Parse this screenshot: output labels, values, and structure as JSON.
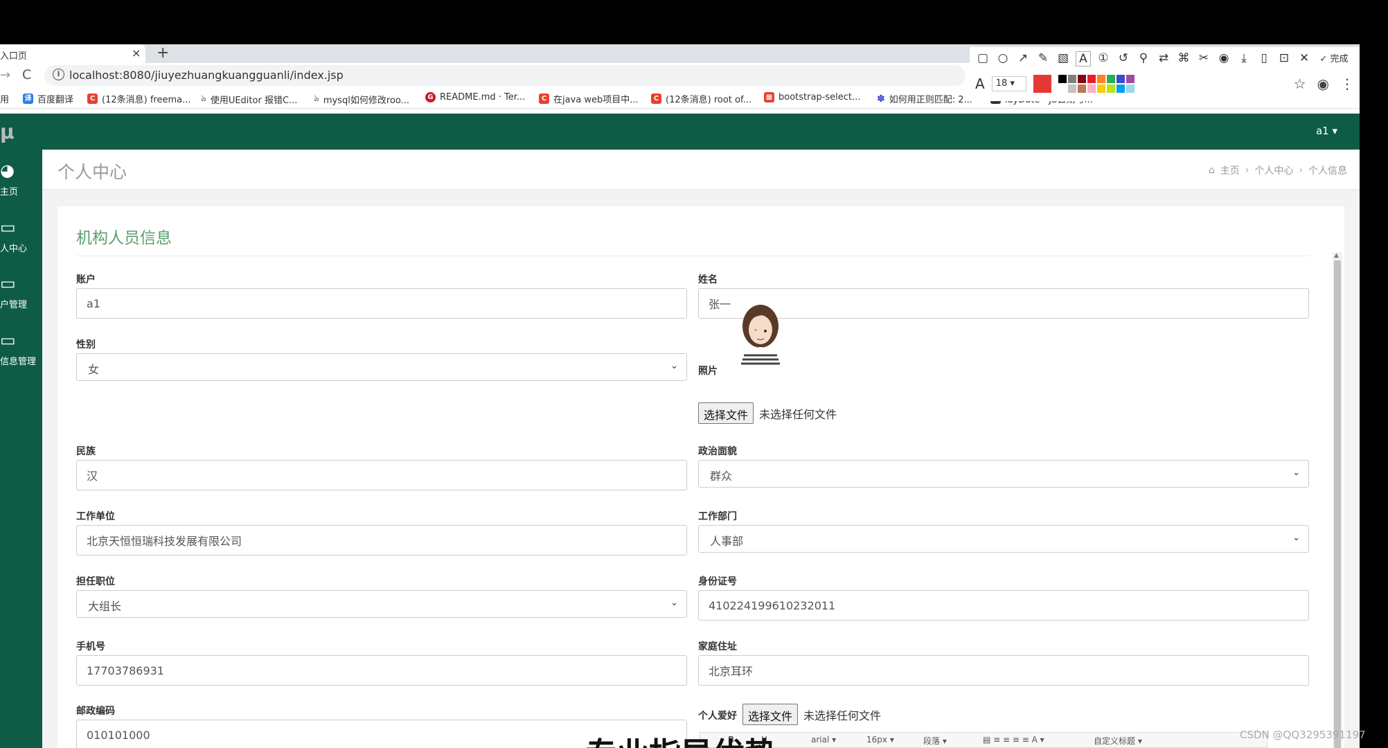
{
  "browser": {
    "tab_title": "入口页",
    "tab_close": "×",
    "new_tab": "+",
    "back": "→",
    "reload": "C",
    "info": "i",
    "url": "localhost:8080/jiuyezhuangkuangguanli/index.jsp",
    "bookmarks": [
      {
        "label": "用",
        "icon": "apps-icon",
        "color": ""
      },
      {
        "label": "百度翻译",
        "icon": "translate-icon",
        "color": "#2b7de9"
      },
      {
        "label": "(12条消息) freema...",
        "icon": "csdn-icon",
        "color": "#e8412c"
      },
      {
        "label": "使用UEditor 报错C...",
        "icon": "link-icon",
        "color": ""
      },
      {
        "label": "mysql如何修改roo...",
        "icon": "link-icon",
        "color": ""
      },
      {
        "label": "README.md · Ter...",
        "icon": "gitee-icon",
        "color": "#c71d23"
      },
      {
        "label": "在java web项目中...",
        "icon": "csdn-icon",
        "color": "#e8412c"
      },
      {
        "label": "(12条消息) root of...",
        "icon": "csdn-icon",
        "color": "#e8412c"
      },
      {
        "label": "bootstrap-select...",
        "icon": "bookmark-icon",
        "color": "#e8412c"
      },
      {
        "label": "如何用正则匹配: 2...",
        "icon": "baidu-icon",
        "color": "#2b3bd6"
      },
      {
        "label": "layDate - JS日期与...",
        "icon": "laydate-icon",
        "color": "#333"
      }
    ]
  },
  "snaptool": {
    "icons": [
      "rect-icon",
      "circle-icon",
      "arrow-icon",
      "pen-icon",
      "mosaic-icon",
      "text-icon",
      "number-icon",
      "undo-icon",
      "pin-icon",
      "translate-icon",
      "ocr-icon",
      "scissors-icon",
      "record-icon",
      "download-icon",
      "phone-icon",
      "save-icon",
      "close-icon"
    ],
    "done_label": "✓ 完成",
    "font_label": "A",
    "font_size": "18",
    "current_color": "#e53935",
    "palette": [
      "#000000",
      "#7f7f7f",
      "#880015",
      "#ed1c24",
      "#ff7f27",
      "#22b14c",
      "#3f48cc",
      "#a349a4",
      "#ffffff",
      "#c3c3c3",
      "#b97a57",
      "#ffaec9",
      "#ffc90e",
      "#b5e61d",
      "#00a2e8",
      "#99d9ea"
    ]
  },
  "app": {
    "logo": "μ",
    "user": "a1 ▾"
  },
  "sidebar": {
    "items": [
      {
        "label": "主页",
        "icon": "dashboard-icon"
      },
      {
        "label": "人中心",
        "icon": "monitor-icon"
      },
      {
        "label": "户管理",
        "icon": "monitor-icon"
      },
      {
        "label": "信息管理",
        "icon": "monitor-icon"
      }
    ]
  },
  "header": {
    "title": "个人中心",
    "breadcrumb": [
      "主页",
      "个人中心",
      "个人信息"
    ],
    "sep": "›"
  },
  "form": {
    "title": "机构人员信息",
    "account_label": "账户",
    "account": "a1",
    "name_label": "姓名",
    "name": "张一",
    "gender_label": "性别",
    "gender": "女",
    "photo_label": "照片",
    "choose_file": "选择文件",
    "no_file": "未选择任何文件",
    "ethnicity_label": "民族",
    "ethnicity": "汉",
    "politics_label": "政治面貌",
    "politics": "群众",
    "workplace_label": "工作单位",
    "workplace": "北京天恒恒瑞科技发展有限公司",
    "department_label": "工作部门",
    "department": "人事部",
    "position_label": "担任职位",
    "position": "大组长",
    "idcard_label": "身份证号",
    "idcard": "410224199610232011",
    "phone_label": "手机号",
    "phone": "17703786931",
    "address_label": "家庭住址",
    "address": "北京耳环",
    "zip_label": "邮政编码",
    "zip": "010101000",
    "hobby_label": "个人爱好"
  },
  "editor": {
    "font": "arial",
    "size": "16px",
    "para": "段落",
    "custom": "自定义标题"
  },
  "overlay": {
    "caption": "专业指导优势",
    "watermark": "CSDN @QQ3295391197"
  }
}
